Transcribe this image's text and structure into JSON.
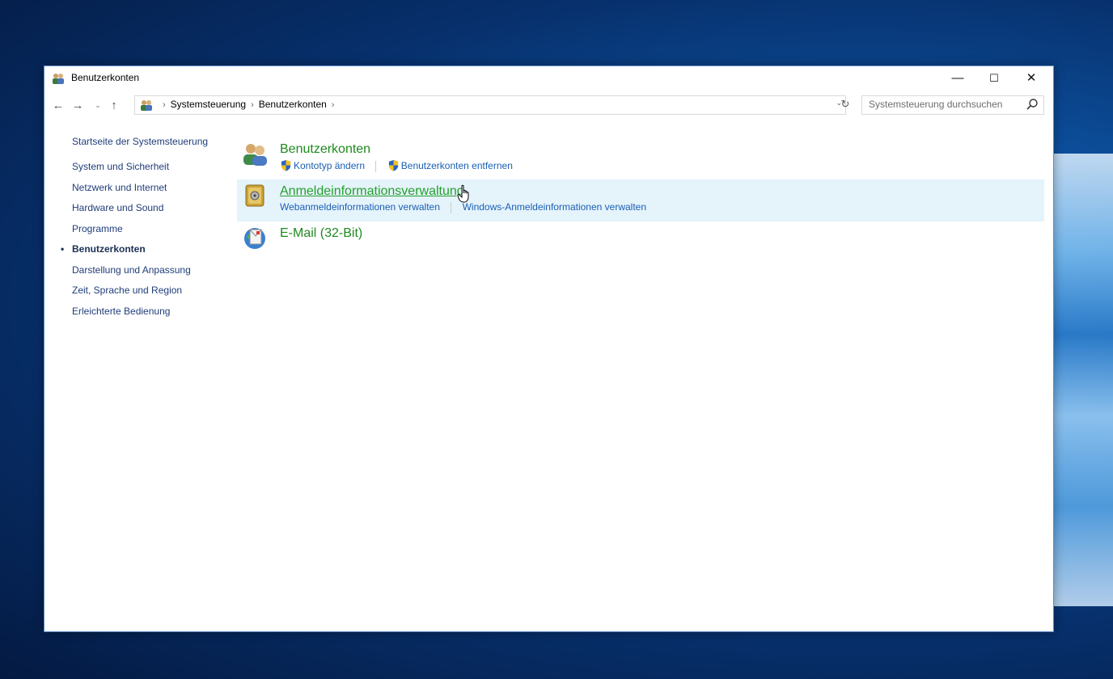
{
  "window": {
    "title": "Benutzerkonten",
    "controls": {
      "minimize": "—",
      "maximize": "☐",
      "close": "✕"
    }
  },
  "navigation": {
    "back": "←",
    "forward": "→",
    "recent": "⌄",
    "up": "↑",
    "breadcrumbs": [
      "Systemsteuerung",
      "Benutzerkonten"
    ],
    "separator": "›",
    "dropdown": "⌄",
    "refresh": "↻",
    "search_placeholder": "Systemsteuerung durchsuchen"
  },
  "sidebar": {
    "home": "Startseite der Systemsteuerung",
    "items": [
      {
        "label": "System und Sicherheit",
        "active": false
      },
      {
        "label": "Netzwerk und Internet",
        "active": false
      },
      {
        "label": "Hardware und Sound",
        "active": false
      },
      {
        "label": "Programme",
        "active": false
      },
      {
        "label": "Benutzerkonten",
        "active": true
      },
      {
        "label": "Darstellung und Anpassung",
        "active": false
      },
      {
        "label": "Zeit, Sprache und Region",
        "active": false
      },
      {
        "label": "Erleichterte Bedienung",
        "active": false
      }
    ],
    "bullet": "•"
  },
  "categories": [
    {
      "title": "Benutzerkonten",
      "icon": "users-icon",
      "links": [
        "Kontotyp ändern",
        "Benutzerkonten entfernen"
      ]
    },
    {
      "title": "Anmeldeinformationsverwaltung",
      "icon": "vault-icon",
      "hovered": true,
      "links": [
        "Webanmeldeinformationen verwalten",
        "Windows-Anmeldeinformationen verwalten"
      ]
    },
    {
      "title": "E-Mail (32-Bit)",
      "icon": "mail-icon",
      "links": []
    }
  ],
  "colors": {
    "category_title": "#1e8a1e",
    "link": "#1a5fb4",
    "hover_bg": "#e5f3fb",
    "sidebar_text": "#1f3d7a"
  }
}
